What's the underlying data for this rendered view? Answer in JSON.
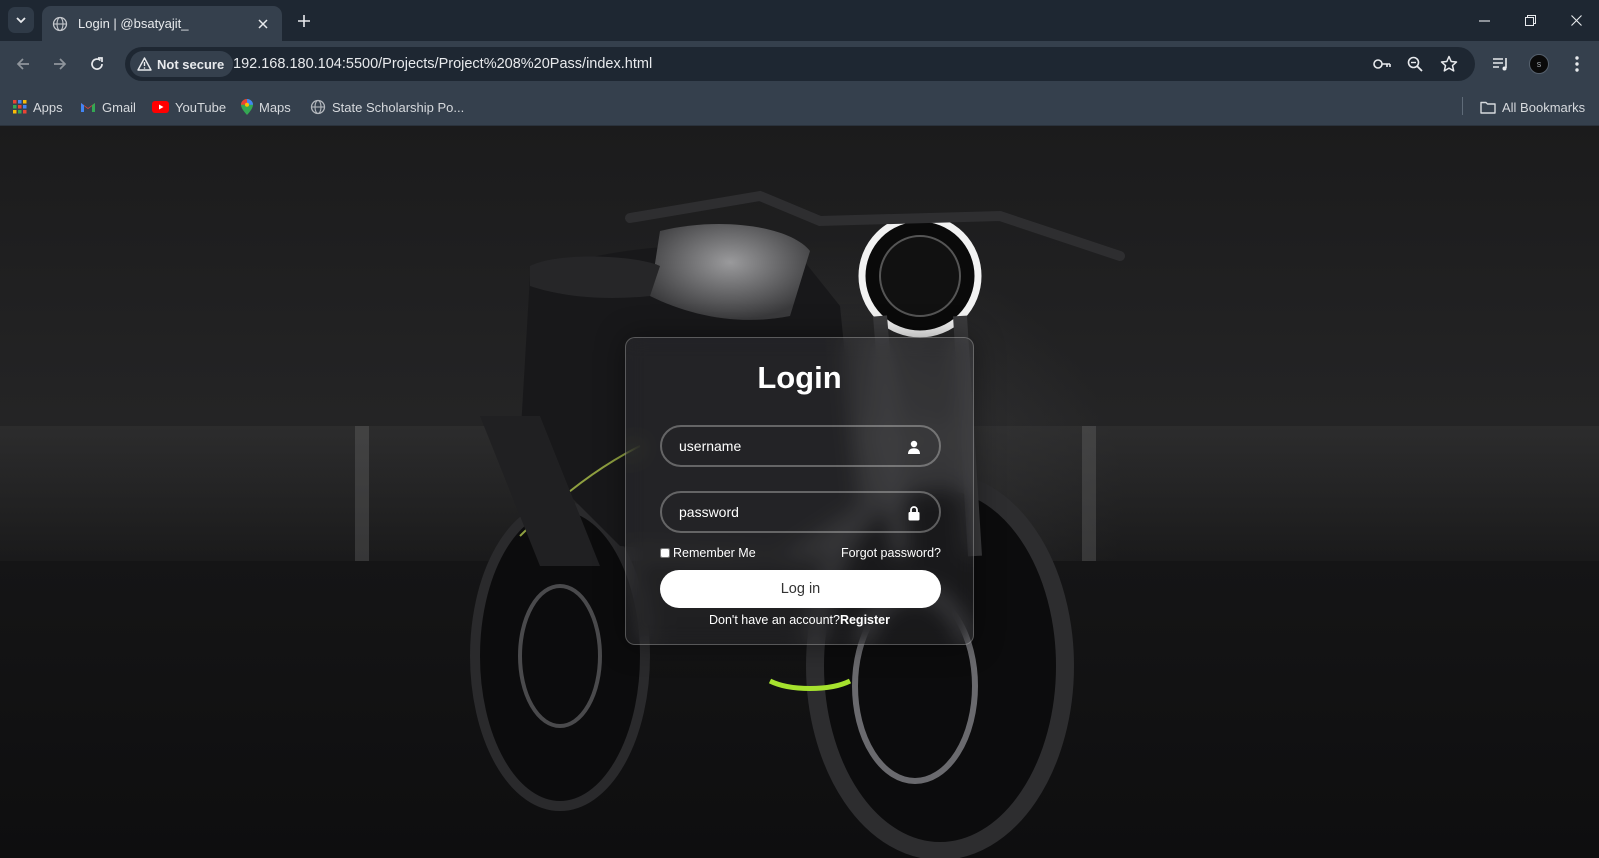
{
  "browser": {
    "tab": {
      "title": "Login | @bsatyajit_"
    },
    "address": {
      "security_label": "Not secure",
      "url": "192.168.180.104:5500/Projects/Project%208%20Pass/index.html"
    },
    "bookmarks": [
      {
        "label": "Apps",
        "icon": "apps-grid-icon"
      },
      {
        "label": "Gmail",
        "icon": "gmail-icon"
      },
      {
        "label": "YouTube",
        "icon": "youtube-icon"
      },
      {
        "label": "Maps",
        "icon": "maps-pin-icon"
      },
      {
        "label": "State Scholarship Po...",
        "icon": "globe-icon"
      }
    ],
    "all_bookmarks_label": "All Bookmarks",
    "profile_initial": "s"
  },
  "login": {
    "title": "Login",
    "username_placeholder": "username",
    "password_placeholder": "password",
    "remember_label": "Remember Me",
    "remember_checked": false,
    "forgot_label": "Forgot password?",
    "button_label": "Log in",
    "register_prompt": "Don't have an account?",
    "register_label": "Register"
  },
  "colors": {
    "chrome_dark": "#1e2732",
    "chrome_light": "#35404d",
    "page_background": "#1a1a1a",
    "text_white": "#ffffff"
  }
}
